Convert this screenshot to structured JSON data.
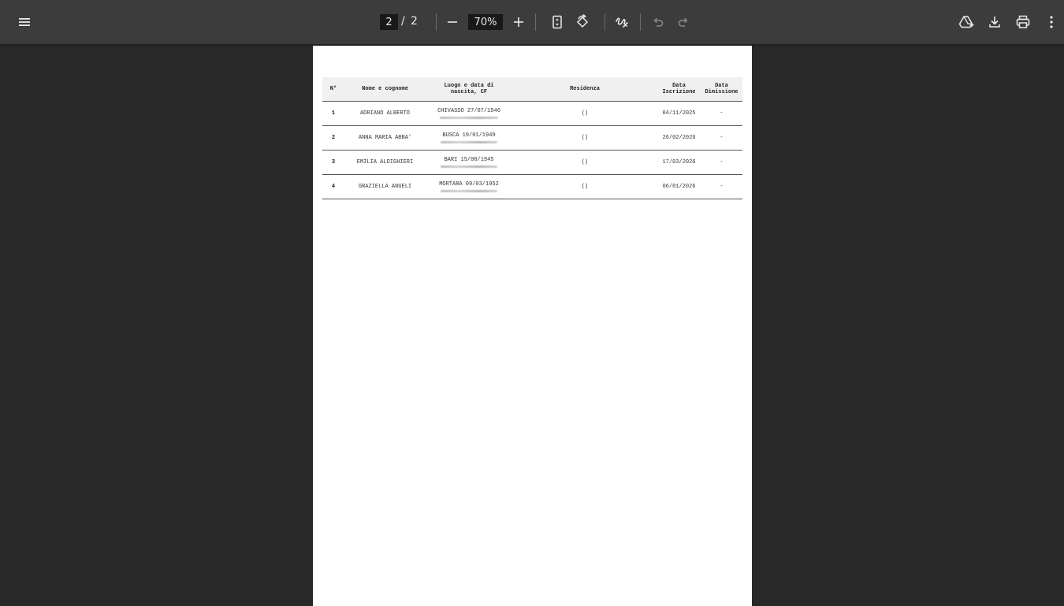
{
  "toolbar": {
    "menu_icon": "menu-icon",
    "page_current": "2",
    "page_separator": "/",
    "page_total": "2",
    "zoom_value": "70%",
    "zoom_out_icon": "minus-icon",
    "zoom_in_icon": "plus-icon",
    "fit_icon": "fit-page-icon",
    "rotate_icon": "rotate-icon",
    "annotate_icon": "draw-icon",
    "undo_icon": "undo-icon",
    "redo_icon": "redo-icon",
    "drive_icon": "add-to-drive-icon",
    "download_icon": "download-icon",
    "print_icon": "print-icon",
    "more_icon": "more-vert-icon"
  },
  "table": {
    "headers": {
      "num": "N°",
      "name": "Nome e cognome",
      "birth_line1": "Luogo e data di",
      "birth_line2": "nascita, CF",
      "residence": "Residenza",
      "reg_line1": "Data",
      "reg_line2": "Iscrizione",
      "dis_line1": "Data",
      "dis_line2": "Dimissione"
    },
    "rows": [
      {
        "num": "1",
        "name": "ADRIANO ALBERTO",
        "birth": "CHIVASSO 27/07/1946",
        "residence": "()",
        "registration": "04/11/2025",
        "dismissal": "-"
      },
      {
        "num": "2",
        "name": "ANNA MARIA ABBA'",
        "birth": "BUSCA 19/01/1949",
        "residence": "()",
        "registration": "26/02/2026",
        "dismissal": "-"
      },
      {
        "num": "3",
        "name": "EMILIA ALDIGHIERI",
        "birth": "BARI 15/08/1945",
        "residence": "()",
        "registration": "17/03/2026",
        "dismissal": "-"
      },
      {
        "num": "4",
        "name": "GRAZIELLA ANGELI",
        "birth": "MORTARA 09/03/1952",
        "residence": "()",
        "registration": "06/01/2026",
        "dismissal": "-"
      }
    ]
  }
}
